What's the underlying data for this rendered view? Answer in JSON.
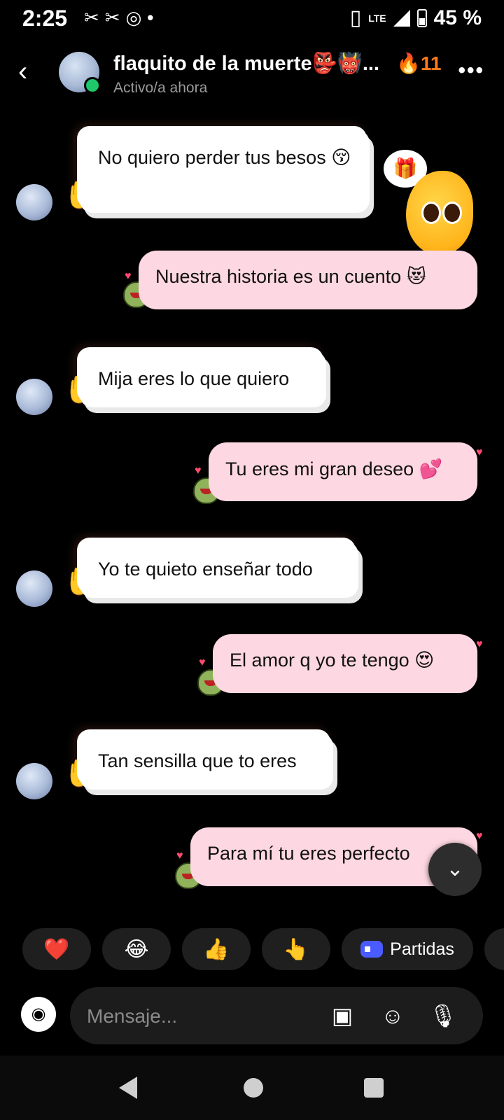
{
  "status_bar": {
    "time": "2:25",
    "left_icons": [
      "✂",
      "✂",
      "◎",
      "•"
    ],
    "network": "LTE",
    "battery": "45 %"
  },
  "header": {
    "contact_name": "flaquito de la muerte👺👹...",
    "streak": "🔥11",
    "status": "Activo/a ahora",
    "more": "•••"
  },
  "messages": [
    {
      "side": "in",
      "text": "No quiero perder tus besos 😚"
    },
    {
      "side": "out",
      "text": "Nuestra historia es un cuento 😻"
    },
    {
      "side": "in",
      "text": "Mija eres lo que quiero"
    },
    {
      "side": "out",
      "text": "Tu eres mi gran deseo 💕"
    },
    {
      "side": "in",
      "text": "Yo te quieto enseñar todo"
    },
    {
      "side": "out",
      "text": "El amor q yo te tengo 😍"
    },
    {
      "side": "in",
      "text": "Tan sensilla que to eres"
    },
    {
      "side": "out",
      "text": "Para mí tu eres perfecto"
    }
  ],
  "quick_replies": {
    "heart": "❤️",
    "laugh": "😂",
    "thumbs": "👍",
    "point": "👆",
    "games_label": "Partidas"
  },
  "composer": {
    "placeholder": "Mensaje..."
  },
  "colors": {
    "incoming_bubble": "#ffffff",
    "outgoing_bubble": "#fdd7e1",
    "online": "#1ec86b"
  }
}
